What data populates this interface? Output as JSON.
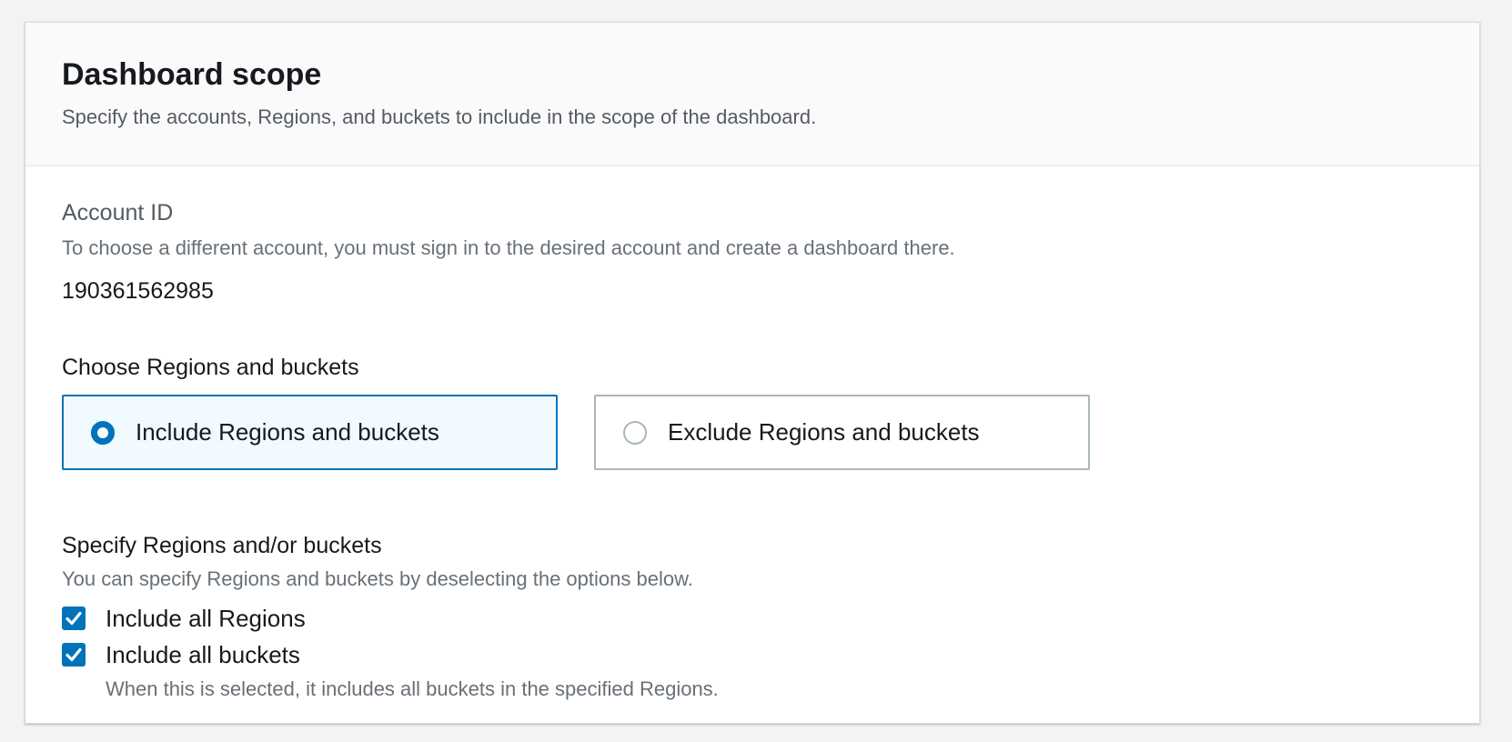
{
  "panel": {
    "title": "Dashboard scope",
    "description": "Specify the accounts, Regions, and buckets to include in the scope of the dashboard."
  },
  "account": {
    "label": "Account ID",
    "hint": "To choose a different account, you must sign in to the desired account and create a dashboard there.",
    "value": "190361562985"
  },
  "regions_choice": {
    "label": "Choose Regions and buckets",
    "options": [
      {
        "label": "Include Regions and buckets",
        "selected": true
      },
      {
        "label": "Exclude Regions and buckets",
        "selected": false
      }
    ]
  },
  "specify": {
    "label": "Specify Regions and/or buckets",
    "hint": "You can specify Regions and buckets by deselecting the options below.",
    "checkboxes": [
      {
        "label": "Include all Regions",
        "checked": true,
        "description": ""
      },
      {
        "label": "Include all buckets",
        "checked": true,
        "description": "When this is selected, it includes all buckets in the specified Regions."
      }
    ]
  },
  "colors": {
    "accent": "#0073bb",
    "selected_tile_bg": "#f1faff",
    "page_bg": "#f2f3f3"
  }
}
